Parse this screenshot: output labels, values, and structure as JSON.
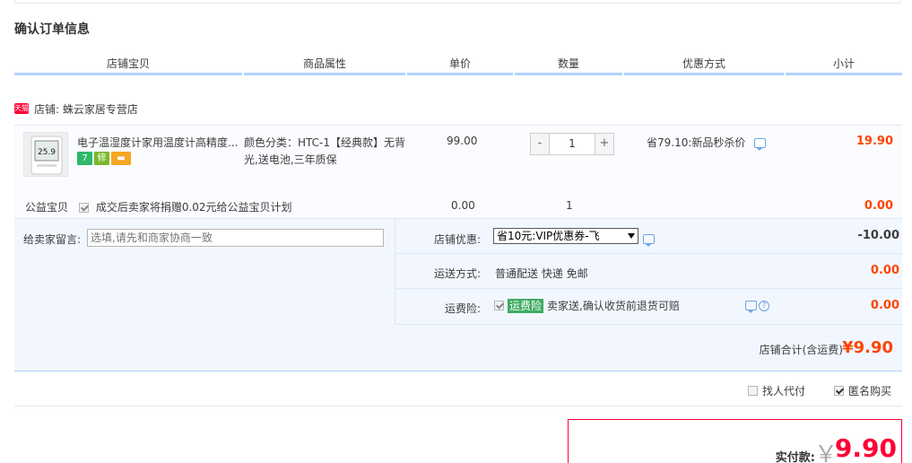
{
  "page": {
    "title": "确认订单信息"
  },
  "columns": [
    "店铺宝贝",
    "商品属性",
    "单价",
    "数量",
    "优惠方式",
    "小计"
  ],
  "shop": {
    "badge": "天猫",
    "label": "店铺: 蛛云家居专营店"
  },
  "item": {
    "title": "电子温湿度计家用温度计高精度...",
    "attr_line1": "颜色分类：HTC-1【经典款】无背",
    "attr_line2": "光,送电池,三年质保",
    "price": "99.00",
    "qty_minus": "-",
    "qty": "1",
    "qty_plus": "+",
    "promo": "省79.10:新品秒杀价",
    "subtotal": "19.90",
    "badges": [
      {
        "text": "7",
        "color": "#2db86a"
      },
      {
        "text": "修",
        "color": "#7ab82d"
      },
      {
        "text": "▬",
        "color": "#f5a623"
      }
    ],
    "thumb_lcd": "25.9"
  },
  "charity": {
    "label": "公益宝贝",
    "text": "成交后卖家将捐赠0.02元给公益宝贝计划",
    "price": "0.00",
    "qty": "1",
    "subtotal": "0.00"
  },
  "message": {
    "label": "给卖家留言:",
    "placeholder": "选填,请先和商家协商一致"
  },
  "discount": {
    "label": "店铺优惠:",
    "selected": "省10元:VIP优惠券-飞",
    "amount": "-10.00"
  },
  "shipping": {
    "label": "运送方式:",
    "value": "普通配送 快递 免邮",
    "amount": "0.00"
  },
  "insurance": {
    "label": "运费险:",
    "tag": "运费险",
    "text": "卖家送,确认收货前退货可赔",
    "amount": "0.00"
  },
  "shop_total": {
    "label": "店铺合计(含运费)",
    "value": "¥9.90"
  },
  "options": {
    "proxy_pay": "找人代付",
    "anonymous": "匿名购买"
  },
  "payment": {
    "label": "实付款:",
    "currency": "￥",
    "value": "9.90"
  }
}
